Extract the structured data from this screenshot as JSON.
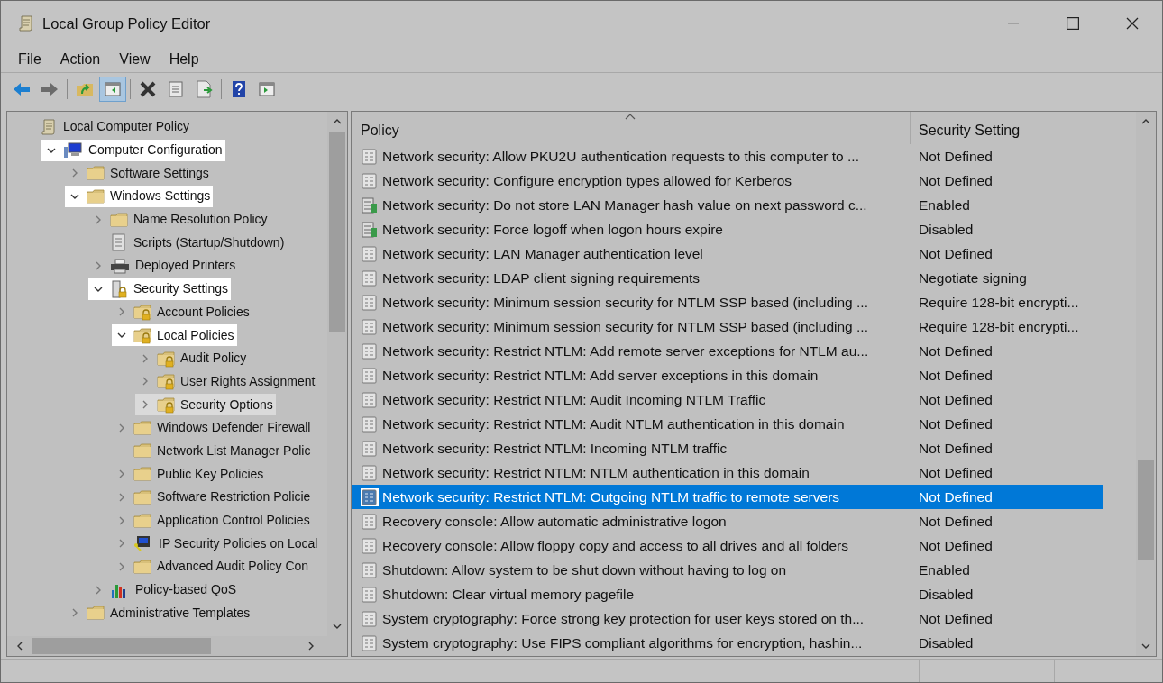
{
  "window": {
    "title": "Local Group Policy Editor"
  },
  "menu": [
    "File",
    "Action",
    "View",
    "Help"
  ],
  "toolbar": [
    {
      "kind": "back",
      "disabled": false,
      "pressed": false
    },
    {
      "kind": "forward",
      "disabled": true,
      "pressed": false
    },
    {
      "kind": "sep"
    },
    {
      "kind": "up",
      "disabled": false,
      "pressed": false
    },
    {
      "kind": "tree",
      "disabled": false,
      "pressed": true
    },
    {
      "kind": "sep"
    },
    {
      "kind": "delete",
      "disabled": false,
      "pressed": false
    },
    {
      "kind": "properties",
      "disabled": false,
      "pressed": false
    },
    {
      "kind": "export",
      "disabled": false,
      "pressed": false
    },
    {
      "kind": "sep"
    },
    {
      "kind": "help",
      "disabled": false,
      "pressed": false
    },
    {
      "kind": "actions",
      "disabled": false,
      "pressed": false
    }
  ],
  "tree": [
    {
      "label": "Local Computer Policy",
      "kind": "scroll",
      "highlighted": false,
      "selected": false,
      "children": [
        {
          "label": "Computer Configuration",
          "kind": "computer",
          "expanded": true,
          "highlighted": true,
          "selected": false,
          "children": [
            {
              "label": "Software Settings",
              "kind": "folder",
              "expanded": false,
              "highlighted": false,
              "selected": false
            },
            {
              "label": "Windows Settings",
              "kind": "folder",
              "expanded": true,
              "highlighted": true,
              "selected": false,
              "children": [
                {
                  "label": "Name Resolution Policy",
                  "kind": "folder",
                  "expanded": false,
                  "highlighted": false,
                  "selected": false
                },
                {
                  "label": "Scripts (Startup/Shutdown)",
                  "kind": "script",
                  "highlighted": false,
                  "selected": false
                },
                {
                  "label": "Deployed Printers",
                  "kind": "printer",
                  "expanded": false,
                  "highlighted": false,
                  "selected": false
                },
                {
                  "label": "Security Settings",
                  "kind": "server-lock",
                  "expanded": true,
                  "highlighted": true,
                  "selected": false,
                  "children": [
                    {
                      "label": "Account Policies",
                      "kind": "lock-folder",
                      "expanded": false,
                      "highlighted": false,
                      "selected": false
                    },
                    {
                      "label": "Local Policies",
                      "kind": "lock-folder",
                      "expanded": true,
                      "highlighted": true,
                      "selected": false,
                      "children": [
                        {
                          "label": "Audit Policy",
                          "kind": "lock-folder",
                          "expanded": false,
                          "highlighted": false,
                          "selected": false
                        },
                        {
                          "label": "User Rights Assignment",
                          "kind": "lock-folder",
                          "expanded": false,
                          "highlighted": false,
                          "selected": false
                        },
                        {
                          "label": "Security Options",
                          "kind": "lock-folder",
                          "expanded": false,
                          "highlighted": false,
                          "selected": true
                        }
                      ]
                    },
                    {
                      "label": "Windows Defender Firewall",
                      "kind": "folder",
                      "expanded": false,
                      "highlighted": false,
                      "selected": false
                    },
                    {
                      "label": "Network List Manager Polic",
                      "kind": "folder",
                      "highlighted": false,
                      "selected": false
                    },
                    {
                      "label": "Public Key Policies",
                      "kind": "folder",
                      "expanded": false,
                      "highlighted": false,
                      "selected": false
                    },
                    {
                      "label": "Software Restriction Policie",
                      "kind": "folder",
                      "expanded": false,
                      "highlighted": false,
                      "selected": false
                    },
                    {
                      "label": "Application Control Policies",
                      "kind": "folder",
                      "expanded": false,
                      "highlighted": false,
                      "selected": false
                    },
                    {
                      "label": "IP Security Policies on Local",
                      "kind": "ip-security",
                      "expanded": false,
                      "highlighted": false,
                      "selected": false
                    },
                    {
                      "label": "Advanced Audit Policy Con",
                      "kind": "folder",
                      "expanded": false,
                      "highlighted": false,
                      "selected": false
                    }
                  ]
                },
                {
                  "label": "Policy-based QoS",
                  "kind": "chart",
                  "expanded": false,
                  "highlighted": false,
                  "selected": false
                }
              ]
            },
            {
              "label": "Administrative Templates",
              "kind": "folder",
              "expanded": false,
              "highlighted": false,
              "selected": false
            }
          ]
        }
      ]
    }
  ],
  "table": {
    "columns": [
      "Policy",
      "Security Setting"
    ],
    "rows": [
      {
        "kind": "policy",
        "policy": "Network security: Allow PKU2U authentication requests to this computer to ...",
        "setting": "Not Defined",
        "selected": false
      },
      {
        "kind": "policy",
        "policy": "Network security: Configure encryption types allowed for Kerberos",
        "setting": "Not Defined",
        "selected": false
      },
      {
        "kind": "server",
        "policy": "Network security: Do not store LAN Manager hash value on next password c...",
        "setting": "Enabled",
        "selected": false
      },
      {
        "kind": "server",
        "policy": "Network security: Force logoff when logon hours expire",
        "setting": "Disabled",
        "selected": false
      },
      {
        "kind": "policy",
        "policy": "Network security: LAN Manager authentication level",
        "setting": "Not Defined",
        "selected": false
      },
      {
        "kind": "policy",
        "policy": "Network security: LDAP client signing requirements",
        "setting": "Negotiate signing",
        "selected": false
      },
      {
        "kind": "policy",
        "policy": "Network security: Minimum session security for NTLM SSP based (including ...",
        "setting": "Require 128-bit encrypti...",
        "selected": false
      },
      {
        "kind": "policy",
        "policy": "Network security: Minimum session security for NTLM SSP based (including ...",
        "setting": "Require 128-bit encrypti...",
        "selected": false
      },
      {
        "kind": "policy",
        "policy": "Network security: Restrict NTLM: Add remote server exceptions for NTLM au...",
        "setting": "Not Defined",
        "selected": false
      },
      {
        "kind": "policy",
        "policy": "Network security: Restrict NTLM: Add server exceptions in this domain",
        "setting": "Not Defined",
        "selected": false
      },
      {
        "kind": "policy",
        "policy": "Network security: Restrict NTLM: Audit Incoming NTLM Traffic",
        "setting": "Not Defined",
        "selected": false
      },
      {
        "kind": "policy",
        "policy": "Network security: Restrict NTLM: Audit NTLM authentication in this domain",
        "setting": "Not Defined",
        "selected": false
      },
      {
        "kind": "policy",
        "policy": "Network security: Restrict NTLM: Incoming NTLM traffic",
        "setting": "Not Defined",
        "selected": false
      },
      {
        "kind": "policy",
        "policy": "Network security: Restrict NTLM: NTLM authentication in this domain",
        "setting": "Not Defined",
        "selected": false
      },
      {
        "kind": "policy",
        "policy": "Network security: Restrict NTLM: Outgoing NTLM traffic to remote servers",
        "setting": "Not Defined",
        "selected": true
      },
      {
        "kind": "policy",
        "policy": "Recovery console: Allow automatic administrative logon",
        "setting": "Not Defined",
        "selected": false
      },
      {
        "kind": "policy",
        "policy": "Recovery console: Allow floppy copy and access to all drives and all folders",
        "setting": "Not Defined",
        "selected": false
      },
      {
        "kind": "policy",
        "policy": "Shutdown: Allow system to be shut down without having to log on",
        "setting": "Enabled",
        "selected": false
      },
      {
        "kind": "policy",
        "policy": "Shutdown: Clear virtual memory pagefile",
        "setting": "Disabled",
        "selected": false
      },
      {
        "kind": "policy",
        "policy": "System cryptography: Force strong key protection for user keys stored on th...",
        "setting": "Not Defined",
        "selected": false
      },
      {
        "kind": "policy",
        "policy": "System cryptography: Use FIPS compliant algorithms for encryption, hashin...",
        "setting": "Disabled",
        "selected": false
      }
    ]
  }
}
